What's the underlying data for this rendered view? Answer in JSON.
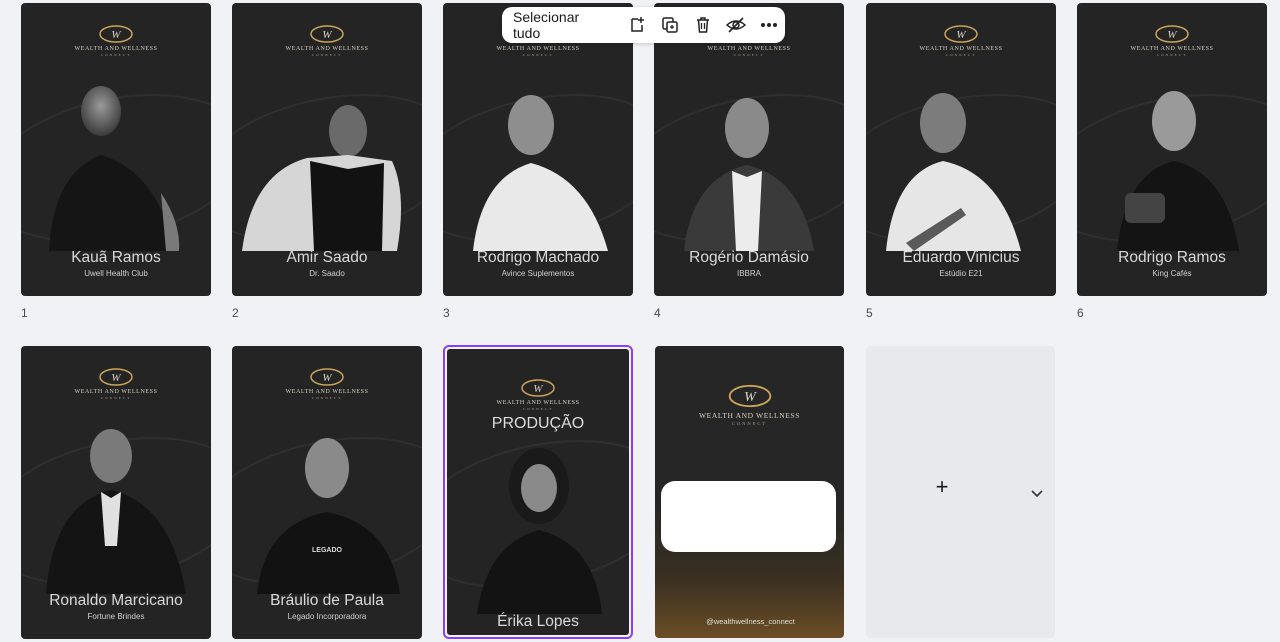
{
  "toolbar": {
    "select_all_label": "Selecionar tudo",
    "actions": [
      {
        "icon": "add-page-icon"
      },
      {
        "icon": "duplicate-icon"
      },
      {
        "icon": "trash-icon"
      },
      {
        "icon": "hide-icon"
      },
      {
        "icon": "more-icon"
      }
    ]
  },
  "brand": {
    "line1": "WEALTH AND WELLNESS",
    "line2": "CONNECT"
  },
  "pages": [
    {
      "number": "1",
      "name": "Kauã Ramos",
      "company": "Uwell Health Club"
    },
    {
      "number": "2",
      "name": "Amir Saado",
      "company": "Dr. Saado"
    },
    {
      "number": "3",
      "name": "Rodrigo Machado",
      "company": "Avince Suplementos"
    },
    {
      "number": "4",
      "name": "Rogério Damásio",
      "company": "IBBRA"
    },
    {
      "number": "5",
      "name": "Eduardo Vinícius",
      "company": "Estúdio E21"
    },
    {
      "number": "6",
      "name": "Rodrigo Ramos",
      "company": "King Cafés"
    },
    {
      "name": "Ronaldo Marcicano",
      "company": "Fortune Brindes"
    },
    {
      "name": "Bráulio de Paula",
      "company": "Legado Incorporadora",
      "shirt_text": "LEGADO"
    },
    {
      "name": "Érika Lopes",
      "heading": "PRODUÇÃO"
    }
  ],
  "closing_page": {
    "handle": "@wealthwellness_connect"
  },
  "add_page": {
    "plus": "+",
    "chevron": "⌄"
  },
  "colors": {
    "selection": "#8b3dff",
    "card_bg": "#242424",
    "logo_gold": "#c9a45a"
  }
}
